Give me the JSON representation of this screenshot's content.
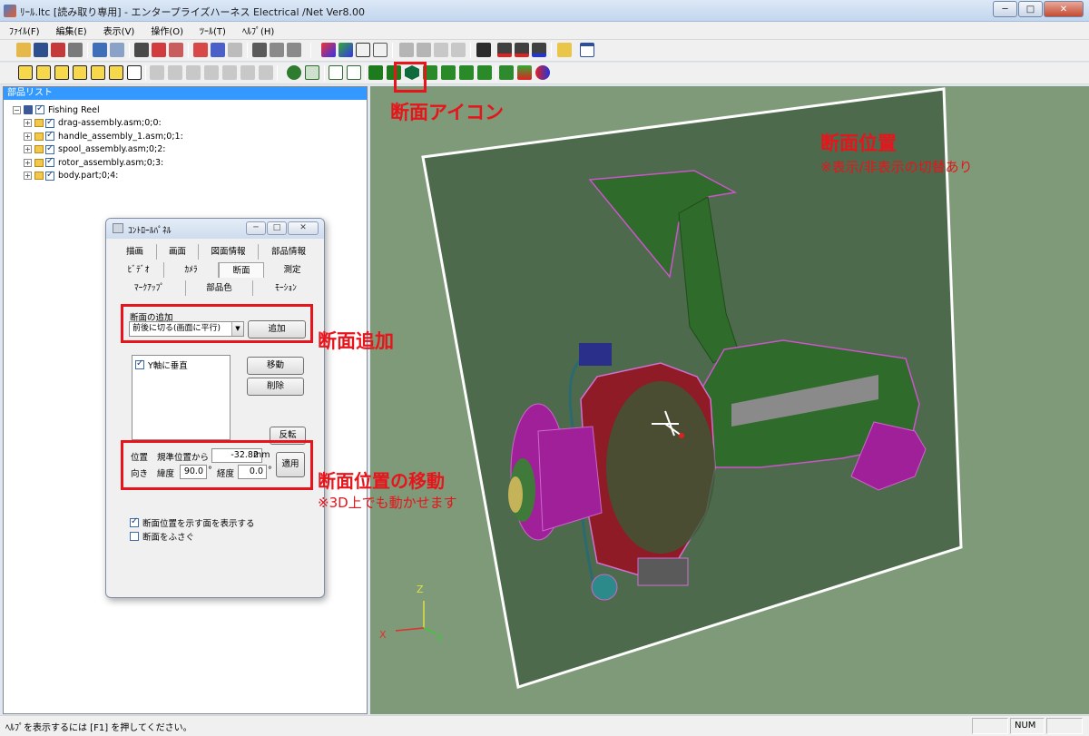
{
  "window": {
    "title": "ﾘｰﾙ.ltc [読み取り専用] - エンタープライズハーネス Electrical /Net Ver8.00",
    "minimize": "─",
    "maximize": "□",
    "close": "✕"
  },
  "menu": [
    "ﾌｧｲﾙ(F)",
    "編集(E)",
    "表示(V)",
    "操作(O)",
    "ﾂｰﾙ(T)",
    "ﾍﾙﾌﾟ(H)"
  ],
  "parts_list": {
    "header": "部品リスト",
    "root": "Fishing Reel",
    "items": [
      "drag-assembly.asm;0;0:",
      "handle_assembly_1.asm;0;1:",
      "spool_assembly.asm;0;2:",
      "rotor_assembly.asm;0;3:",
      "body.part;0;4:"
    ]
  },
  "control_panel": {
    "title": "ｺﾝﾄﾛｰﾙﾊﾟﾈﾙ",
    "tabs_row1": [
      "描画",
      "画面",
      "図面情報",
      "部品情報"
    ],
    "tabs_row2": [
      "ﾋﾞﾃﾞｵ",
      "ｶﾒﾗ",
      "断面",
      "測定"
    ],
    "tabs_row3": [
      "ﾏｰｸｱｯﾌﾟ",
      "部品色",
      "ﾓｰｼｮﾝ"
    ],
    "add_section_label": "断面の追加",
    "add_section_option": "前後に切る(画面に平行)",
    "add_button": "追加",
    "section_item": "Y軸に垂直",
    "move_button": "移動",
    "delete_button": "削除",
    "reverse_button": "反転",
    "position_label": "位置",
    "from_reference_label": "規準位置から",
    "position_value": "-32.82",
    "position_unit": "mm",
    "direction_label": "向き",
    "latitude_label": "緯度",
    "latitude_value": "90.0",
    "degree_unit": "°",
    "longitude_label": "経度",
    "longitude_value": "0.0",
    "apply_button": "適用",
    "show_plane_label": "断面位置を示す面を表示する",
    "show_plane_checked": true,
    "cap_section_label": "断面をふさぐ",
    "cap_section_checked": false
  },
  "annotations": {
    "section_icon": "断面アイコン",
    "section_position": "断面位置",
    "section_position_note": "※表示/非表示の切替あり",
    "add_section": "断面追加",
    "move_section": "断面位置の移動",
    "move_section_note": "※3D上でも動かせます"
  },
  "axes": {
    "z": "Z",
    "x": "X",
    "y": "Y"
  },
  "status": {
    "message": "ﾍﾙﾌﾟを表示するには [F1] を押してください。",
    "num": "NUM"
  },
  "colors": {
    "annotation_red": "#e8141b",
    "viewport_bg": "#7f9a78",
    "reel_green": "#2f6b2a",
    "reel_red": "#8e1b26",
    "reel_magenta": "#a0209a"
  }
}
